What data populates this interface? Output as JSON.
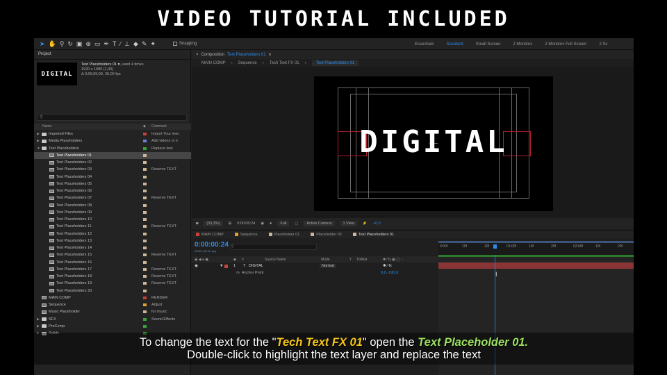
{
  "banner": {
    "title": "VIDEO TUTORIAL INCLUDED"
  },
  "toolbar": {
    "snapping": "Snapping",
    "workspaces": [
      "Essentials",
      "Standard",
      "Small Screen",
      "2 Monitors",
      "2 Monitors Full Screen",
      "2 Sc"
    ],
    "active_workspace": "Standard"
  },
  "project": {
    "tab": "Project",
    "thumb_text": "DIGITAL",
    "comp_name": "Text Placeholders 01 ▾",
    "used": ", used 4 times",
    "size": "1920 x 1080 (1,00)",
    "duration": "Δ 0;00;05;00, 30,00 fps",
    "columns": {
      "name": "Name",
      "comment": "Comment"
    },
    "items": [
      {
        "name": "Imported Files",
        "type": "folder",
        "indent": 0,
        "expand": "▶",
        "label": "#c8443a",
        "comment": "Import Your mec"
      },
      {
        "name": "Media Placeholders",
        "type": "folder",
        "indent": 0,
        "expand": "▶",
        "label": "#6b7fd6",
        "comment": "Add videos or ir"
      },
      {
        "name": "Text Placeholders",
        "type": "folder",
        "indent": 0,
        "expand": "▼",
        "label": "#3da23d",
        "comment": "Replace text"
      },
      {
        "name": "Text Placeholders 01",
        "type": "comp",
        "indent": 1,
        "label": "#c8b898",
        "comment": "",
        "selected": true
      },
      {
        "name": "Text Placeholders 02",
        "type": "comp",
        "indent": 1,
        "label": "#c8b898",
        "comment": ""
      },
      {
        "name": "Text Placeholders 03",
        "type": "comp",
        "indent": 1,
        "label": "#c8b898",
        "comment": "Reserve TEXT"
      },
      {
        "name": "Text Placeholders 04",
        "type": "comp",
        "indent": 1,
        "label": "#c8b898",
        "comment": ""
      },
      {
        "name": "Text Placeholders 05",
        "type": "comp",
        "indent": 1,
        "label": "#c8b898",
        "comment": ""
      },
      {
        "name": "Text Placeholders 06",
        "type": "comp",
        "indent": 1,
        "label": "#c8b898",
        "comment": ""
      },
      {
        "name": "Text Placeholders 07",
        "type": "comp",
        "indent": 1,
        "label": "#c8b898",
        "comment": "Reserve TEXT"
      },
      {
        "name": "Text Placeholders 08",
        "type": "comp",
        "indent": 1,
        "label": "#c8b898",
        "comment": ""
      },
      {
        "name": "Text Placeholders 09",
        "type": "comp",
        "indent": 1,
        "label": "#c8b898",
        "comment": ""
      },
      {
        "name": "Text Placeholders 10",
        "type": "comp",
        "indent": 1,
        "label": "#c8b898",
        "comment": ""
      },
      {
        "name": "Text Placeholders 11",
        "type": "comp",
        "indent": 1,
        "label": "#c8b898",
        "comment": "Reserve TEXT"
      },
      {
        "name": "Text Placeholders 12",
        "type": "comp",
        "indent": 1,
        "label": "#c8b898",
        "comment": ""
      },
      {
        "name": "Text Placeholders 13",
        "type": "comp",
        "indent": 1,
        "label": "#c8b898",
        "comment": ""
      },
      {
        "name": "Text Placeholders 14",
        "type": "comp",
        "indent": 1,
        "label": "#c8b898",
        "comment": ""
      },
      {
        "name": "Text Placeholders 15",
        "type": "comp",
        "indent": 1,
        "label": "#c8b898",
        "comment": "Reserve TEXT"
      },
      {
        "name": "Text Placeholders 16",
        "type": "comp",
        "indent": 1,
        "label": "#c8b898",
        "comment": ""
      },
      {
        "name": "Text Placeholders 17",
        "type": "comp",
        "indent": 1,
        "label": "#c8b898",
        "comment": "Reserve TEXT"
      },
      {
        "name": "Text Placeholders 18",
        "type": "comp",
        "indent": 1,
        "label": "#c8b898",
        "comment": "Reserve TEXT"
      },
      {
        "name": "Text Placeholders 19",
        "type": "comp",
        "indent": 1,
        "label": "#c8b898",
        "comment": "Reserve TEXT"
      },
      {
        "name": "Text Placeholders 20",
        "type": "comp",
        "indent": 1,
        "label": "#c8b898",
        "comment": ""
      },
      {
        "name": "MAIN COMP",
        "type": "comp",
        "indent": 0,
        "label": "#c8443a",
        "comment": "RENDER"
      },
      {
        "name": "Sequence",
        "type": "comp",
        "indent": 0,
        "label": "#e0a030",
        "comment": "Adjust"
      },
      {
        "name": "Music Placeholder",
        "type": "comp",
        "indent": 0,
        "label": "#c8b898",
        "comment": "for music"
      },
      {
        "name": "SFX",
        "type": "folder",
        "indent": 0,
        "expand": "▶",
        "label": "#3da23d",
        "comment": "Sound Effects"
      },
      {
        "name": "PreComp",
        "type": "folder",
        "indent": 0,
        "expand": "▶",
        "label": "#3da23d",
        "comment": ""
      },
      {
        "name": "Solids",
        "type": "folder",
        "indent": 0,
        "expand": "▶",
        "label": "#3da23d",
        "comment": ""
      }
    ]
  },
  "viewer": {
    "tab_prefix": "Composition",
    "tab_name": "Text Placeholders 01",
    "breadcrumbs": [
      "MAIN COMP",
      "Sequence",
      "Tech Text FX 01",
      "Text Placeholders 01"
    ],
    "active_crumb": "Text Placeholders 01",
    "canvas_text": "DIGITAL",
    "zoom": "(33,3%)",
    "time": "0:00:00:24",
    "resolution": "Full",
    "camera": "Active Camera",
    "views": "1 View",
    "exposure": "+0,0"
  },
  "timeline": {
    "tabs": [
      {
        "name": "MAIN COMP",
        "color": "#c8443a"
      },
      {
        "name": "Sequence",
        "color": "#e0a030"
      },
      {
        "name": "Placeholder 01",
        "color": "#c8b898"
      },
      {
        "name": "Placeholder 02",
        "color": "#c8b898"
      },
      {
        "name": "Text Placeholders 01",
        "color": "#c8b898",
        "active": true
      }
    ],
    "timecode": "0:00:00:24",
    "fps": "00024 (30.00 fps)",
    "ruler_ticks": [
      "0:00f",
      "10f",
      "20f",
      "01:00f",
      "10f",
      "20f",
      "02:00f",
      "10f",
      "20f"
    ],
    "columns": {
      "source": "Source Name",
      "mode": "Mode",
      "t": "T",
      "trkmat": "TrkMat"
    },
    "layer": {
      "index": "1",
      "type": "T",
      "name": "DIGITAL",
      "mode": "Normal"
    },
    "property": {
      "name": "Anchor Point",
      "value": "0,0,-190,0"
    }
  },
  "subtitle": {
    "line1_a": "To change the text for the \"",
    "line1_b": "Tech Text FX 01",
    "line1_c": "\" open the ",
    "line1_d": "Text Placeholder 01.",
    "line2": "Double-click to highlight the text layer and replace the text"
  }
}
